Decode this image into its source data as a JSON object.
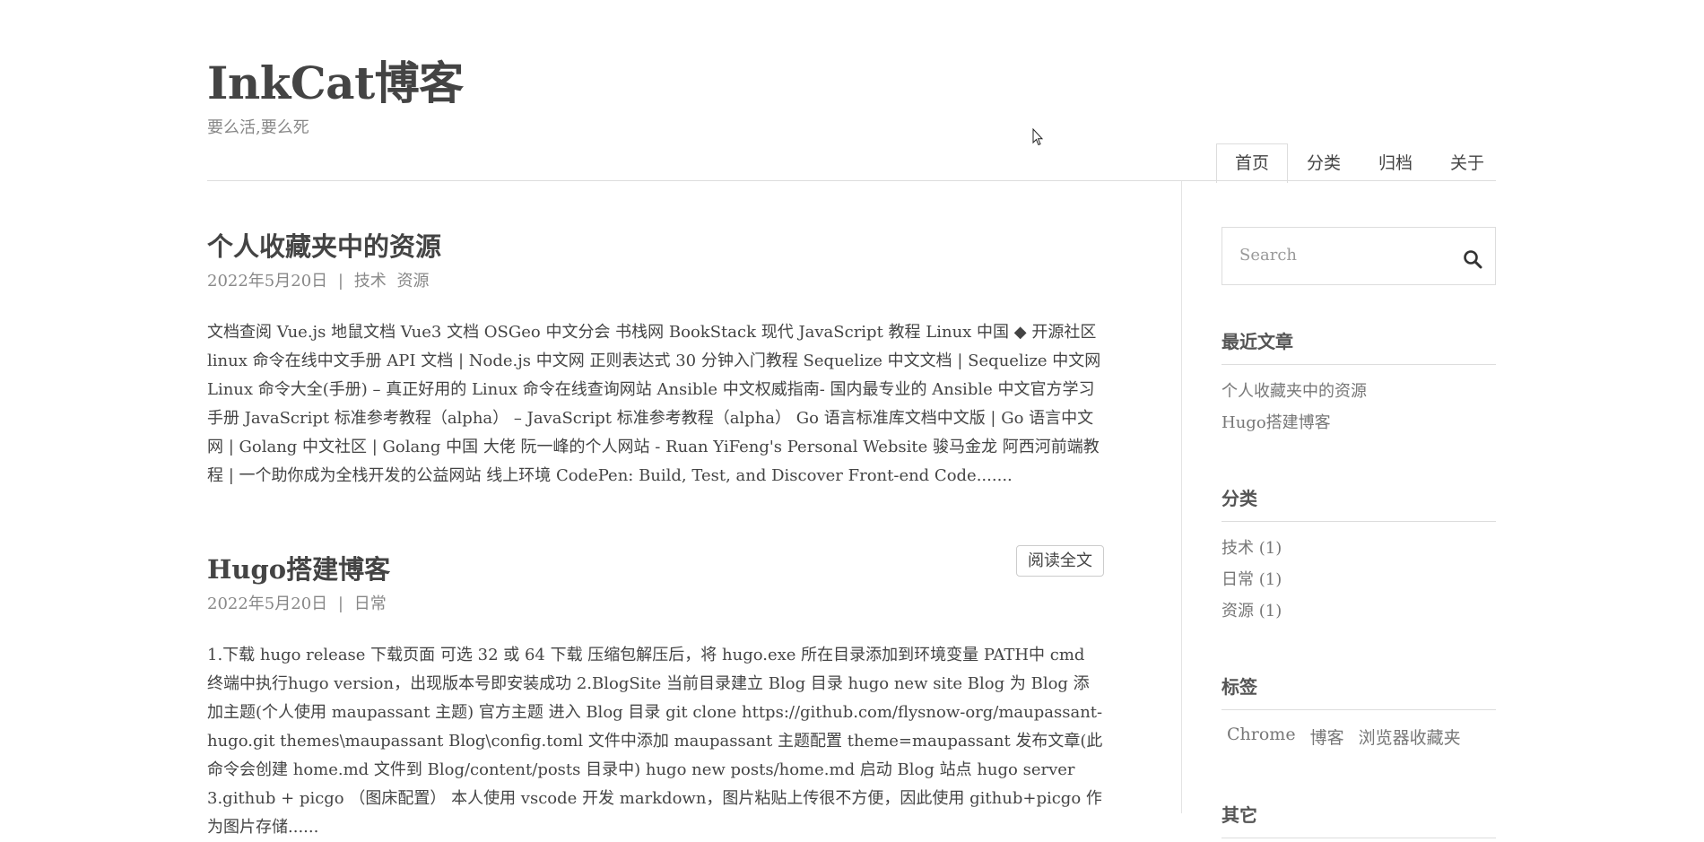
{
  "site": {
    "title": "InkCat博客",
    "subtitle": "要么活,要么死"
  },
  "nav": {
    "items": [
      "首页",
      "分类",
      "归档",
      "关于"
    ],
    "active": "首页"
  },
  "posts": [
    {
      "title": "个人收藏夹中的资源",
      "date": "2022年5月20日",
      "separator": "|",
      "categories": [
        "技术",
        "资源"
      ],
      "excerpt": "文档查阅 Vue.js 地鼠文档 Vue3 文档 OSGeo 中文分会 书栈网 BookStack 现代 JavaScript 教程 Linux 中国 ◆ 开源社区 linux 命令在线中文手册 API 文档 | Node.js 中文网 正则表达式 30 分钟入门教程 Sequelize 中文文档 | Sequelize 中文网 Linux 命令大全(手册) – 真正好用的 Linux 命令在线查询网站 Ansible 中文权威指南- 国内最专业的 Ansible 中文官方学习手册 JavaScript 标准参考教程（alpha） – JavaScript 标准参考教程（alpha） Go 语言标准库文档中文版 | Go 语言中文网 | Golang 中文社区 | Golang 中国 大佬 阮一峰的个人网站 - Ruan YiFeng's Personal Website 骏马金龙 阿西河前端教程 | 一个助你成为全栈开发的公益网站 线上环境 CodePen: Build, Test, and Discover Front-end Code.......",
      "read_more": "阅读全文"
    },
    {
      "title": "Hugo搭建博客",
      "date": "2022年5月20日",
      "separator": "|",
      "categories": [
        "日常"
      ],
      "excerpt": "1.下载 hugo release 下载页面 可选 32 或 64 下载 压缩包解压后，将 hugo.exe 所在目录添加到环境变量 PATH中 cmd 终端中执行hugo version，出现版本号即安装成功 2.BlogSite 当前目录建立 Blog 目录 hugo new site Blog 为 Blog 添加主题(个人使用 maupassant 主题) 官方主题 进入 Blog 目录 git clone https://github.com/flysnow-org/maupassant-hugo.git themes\\maupassant Blog\\config.toml 文件中添加 maupassant 主题配置 theme=maupassant 发布文章(此命令会创建 home.md 文件到 Blog/content/posts 目录中) hugo new posts/home.md 启动 Blog 站点 hugo server 3.github + picgo （图床配置） 本人使用 vscode 开发 markdown，图片粘贴上传很不方便，因此使用 github+picgo 作为图片存储......"
    }
  ],
  "sidebar": {
    "search_placeholder": "Search",
    "recent": {
      "title": "最近文章",
      "items": [
        "个人收藏夹中的资源",
        "Hugo搭建博客"
      ]
    },
    "categories": {
      "title": "分类",
      "items": [
        "技术 (1)",
        "日常 (1)",
        "资源 (1)"
      ]
    },
    "tags": {
      "title": "标签",
      "items": [
        "Chrome",
        "博客",
        "浏览器收藏夹"
      ]
    },
    "other": {
      "title": "其它"
    }
  },
  "icons": {
    "search": "search-icon",
    "cursor": "mouse-pointer-icon"
  },
  "colors": {
    "text": "#444444",
    "muted": "#888888",
    "border": "#dddddd"
  }
}
